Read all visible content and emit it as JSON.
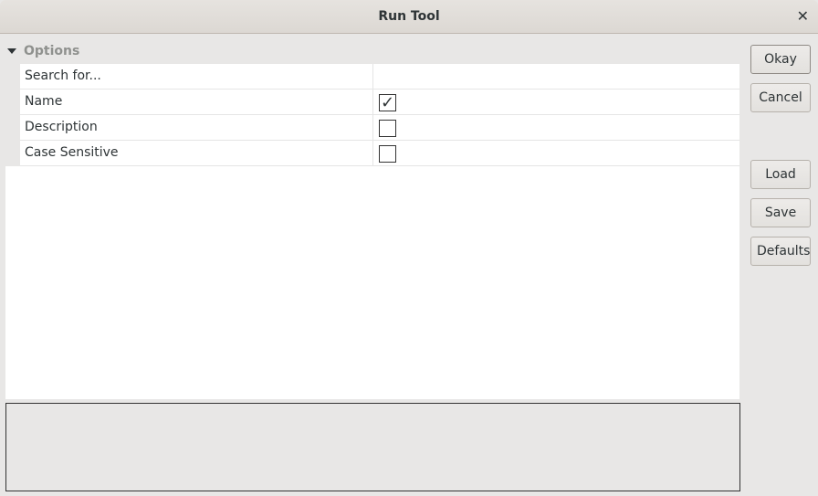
{
  "window": {
    "title": "Run Tool",
    "close_icon": "close-icon"
  },
  "options": {
    "section_label": "Options",
    "rows": [
      {
        "label": "Search for...",
        "value": ""
      },
      {
        "label": "Name",
        "checked": true
      },
      {
        "label": "Description",
        "checked": false
      },
      {
        "label": "Case Sensitive",
        "checked": false
      }
    ]
  },
  "buttons": {
    "okay": "Okay",
    "cancel": "Cancel",
    "load": "Load",
    "save": "Save",
    "defaults": "Defaults"
  }
}
